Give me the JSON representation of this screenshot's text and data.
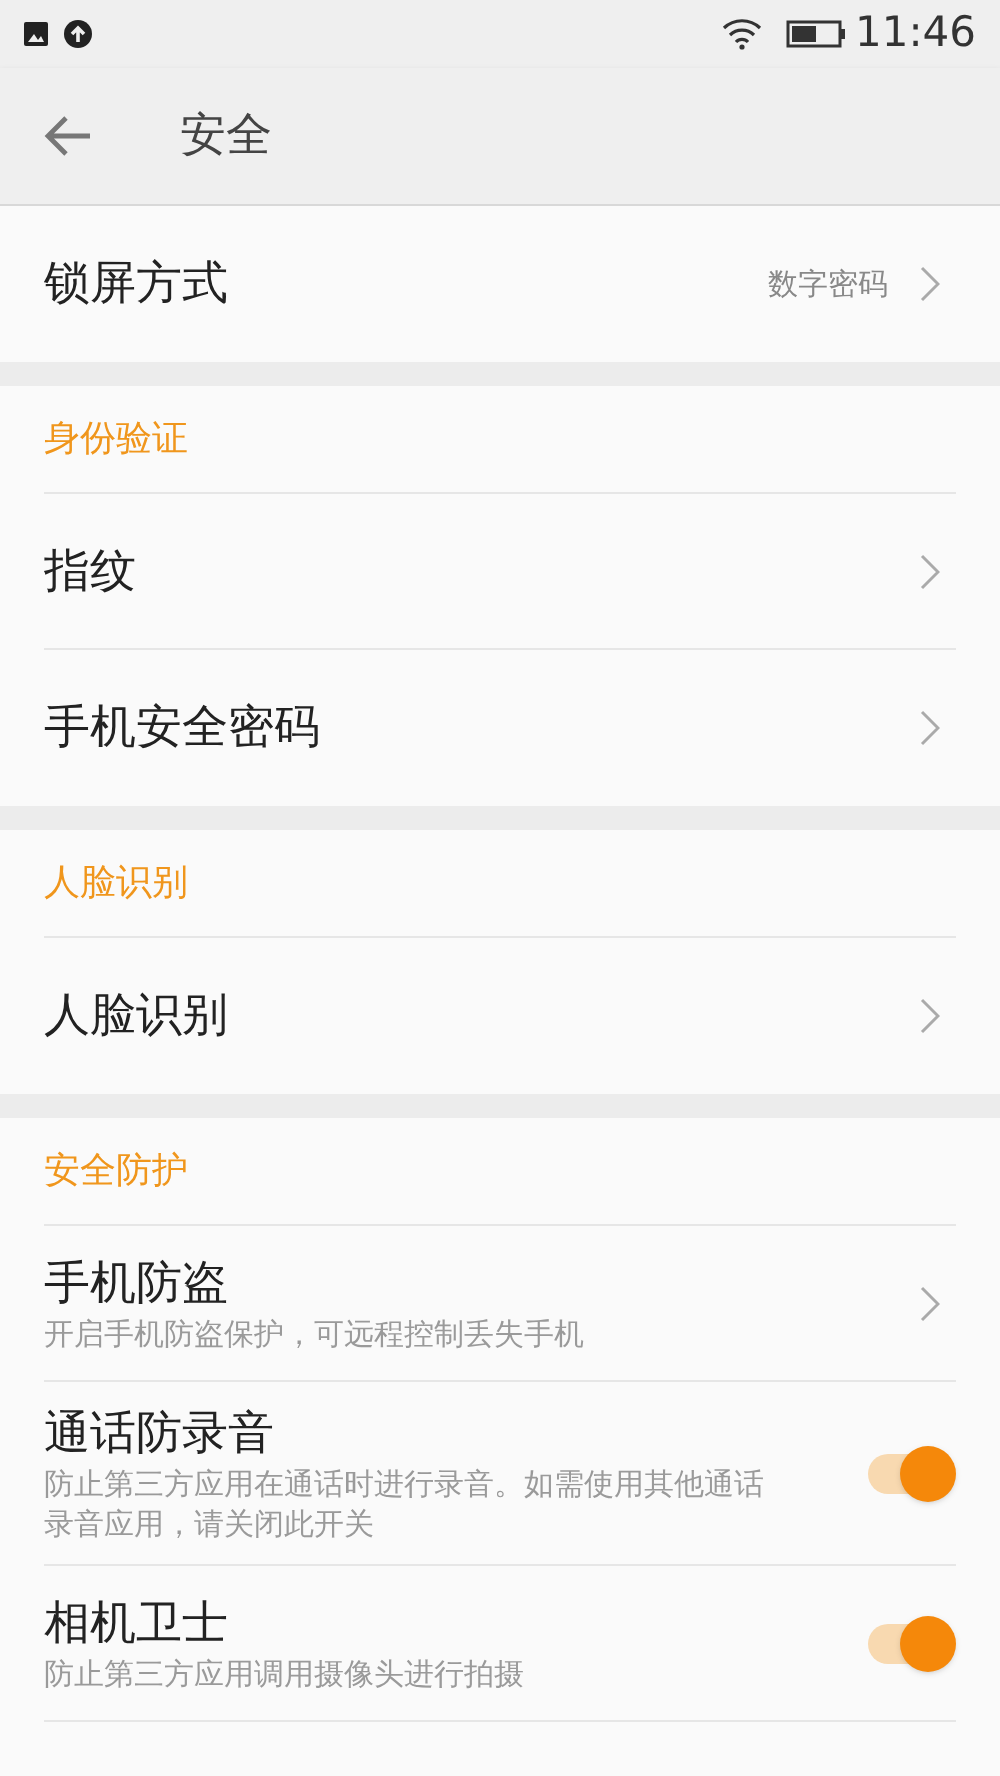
{
  "status_bar": {
    "time": "11:46"
  },
  "app_bar": {
    "title": "安全"
  },
  "sections": [
    {
      "items": [
        {
          "kind": "link",
          "title": "锁屏方式",
          "value": "数字密码"
        }
      ]
    },
    {
      "header": "身份验证",
      "items": [
        {
          "kind": "link",
          "title": "指纹"
        },
        {
          "kind": "link",
          "title": "手机安全密码"
        }
      ]
    },
    {
      "header": "人脸识别",
      "items": [
        {
          "kind": "link",
          "title": "人脸识别"
        }
      ]
    },
    {
      "header": "安全防护",
      "items": [
        {
          "kind": "link",
          "title": "手机防盗",
          "subtitle": "开启手机防盗保护，可远程控制丢失手机"
        },
        {
          "kind": "toggle",
          "title": "通话防录音",
          "subtitle": "防止第三方应用在通话时进行录音。如需使用其他通话录音应用，请关闭此开关",
          "on": true
        },
        {
          "kind": "toggle",
          "title": "相机卫士",
          "subtitle": "防止第三方应用调用摄像头进行拍摄",
          "on": true
        }
      ]
    }
  ]
}
